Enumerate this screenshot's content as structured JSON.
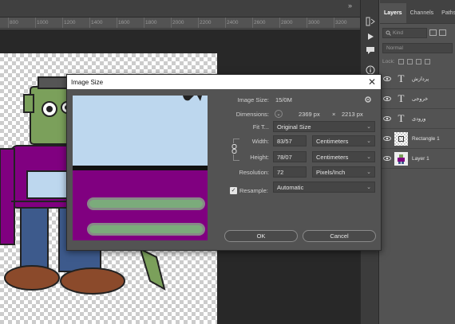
{
  "ruler": {
    "ticks": [
      "800",
      "1000",
      "1200",
      "1400",
      "1600",
      "1800",
      "2000",
      "2200",
      "2400",
      "2600",
      "2800",
      "3000",
      "3200"
    ]
  },
  "layers_panel": {
    "tabs": [
      "Layers",
      "Channels",
      "Paths"
    ],
    "kind_placeholder": "Kind",
    "blend_mode": "Normal",
    "lock_label": "Lock:",
    "layers": [
      {
        "name": "پردازش",
        "type": "text"
      },
      {
        "name": "خروجی",
        "type": "text"
      },
      {
        "name": "ورودی",
        "type": "text"
      },
      {
        "name": "Rectangle 1",
        "type": "shape"
      },
      {
        "name": "Layer 1",
        "type": "image"
      }
    ]
  },
  "dialog": {
    "title": "Image Size",
    "image_size_label": "Image Size:",
    "image_size_value": "15/0M",
    "dimensions_label": "Dimensions:",
    "dimensions_width": "2369 px",
    "dimensions_sep": "×",
    "dimensions_height": "2213 px",
    "fit_to_label": "Fit T...",
    "fit_to_value": "Original Size",
    "width_label": "Width:",
    "width_value": "83/57",
    "width_unit": "Centimeters",
    "height_label": "Height:",
    "height_value": "78/07",
    "height_unit": "Centimeters",
    "resolution_label": "Resolution:",
    "resolution_value": "72",
    "resolution_unit": "Pixels/Inch",
    "resample_label": "Resample:",
    "resample_checked": true,
    "resample_value": "Automatic",
    "ok_label": "OK",
    "cancel_label": "Cancel",
    "close_glyph": "✕"
  },
  "colors": {
    "shirt": "#800080",
    "skin": "#7ba05b",
    "sky": "#bdd7ee",
    "pants": "#3d5a8c",
    "shoes": "#8b4a2b"
  }
}
